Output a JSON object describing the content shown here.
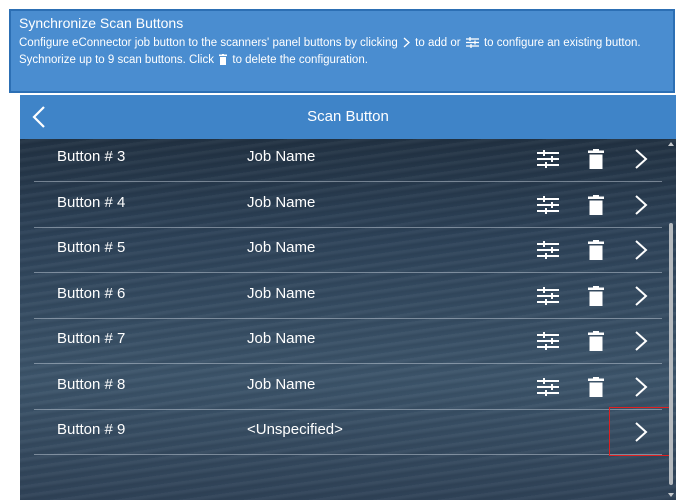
{
  "info": {
    "title": "Synchronize Scan Buttons",
    "desc_part1": "Configure eConnector job button to the scanners' panel buttons by clicking",
    "desc_part2": "to add or",
    "desc_part3": "to configure an existing button. Sychnorize up to 9 scan buttons. Click",
    "desc_part4": "to delete the configuration."
  },
  "header": {
    "title": "Scan Button"
  },
  "rows": [
    {
      "button": "Button # 3",
      "job": "Job Name",
      "has_actions": true
    },
    {
      "button": "Button # 4",
      "job": "Job Name",
      "has_actions": true
    },
    {
      "button": "Button # 5",
      "job": "Job Name",
      "has_actions": true
    },
    {
      "button": "Button # 6",
      "job": "Job Name",
      "has_actions": true
    },
    {
      "button": "Button # 7",
      "job": "Job Name",
      "has_actions": true
    },
    {
      "button": "Button # 8",
      "job": "Job Name",
      "has_actions": true
    },
    {
      "button": "Button # 9",
      "job": "<Unspecified>",
      "has_actions": false
    }
  ],
  "icons": {
    "back": "chevron-left-icon",
    "configure": "sliders-icon",
    "delete": "trash-icon",
    "open": "chevron-right-icon"
  },
  "colors": {
    "info_bg": "#4a8dd0",
    "header_bg": "#3f84c8",
    "highlight": "#e02020"
  }
}
